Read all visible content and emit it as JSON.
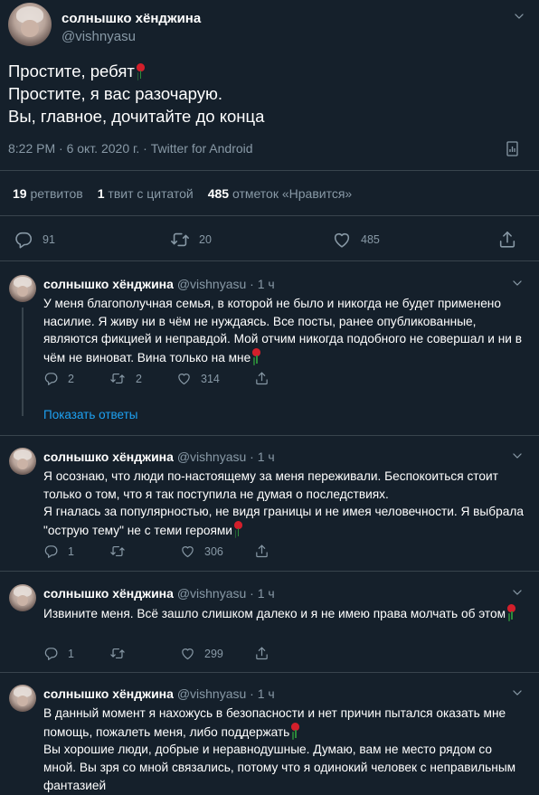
{
  "main_tweet": {
    "name": "солнышко хёнджина",
    "handle": "@vishnyasu",
    "lines": [
      "Простите, ребят",
      "Простите, я вас разочарую.",
      "Вы, главное, дочитайте до конца"
    ],
    "meta": "8:22 PM · 6 окт. 2020 г. · Twitter for Android",
    "stats": {
      "retweets_count": "19",
      "retweets_label": "ретвитов",
      "quotes_count": "1",
      "quotes_label": "твит с цитатой",
      "likes_count": "485",
      "likes_label": "отметок «Нравится»"
    },
    "actions": {
      "replies": "91",
      "retweets": "20",
      "likes": "485"
    }
  },
  "replies": [
    {
      "name": "солнышко хёнджина",
      "handle": "@vishnyasu · 1 ч",
      "text": "У меня благополучная семья, в которой не было и никогда не будет применено насилие. Я живу ни в чём не нуждаясь. Все посты, ранее опубликованные, являются фикцией и неправдой. Мой отчим никогда подобного не совершал и ни в чём не виноват. Вина только на мне",
      "replies": "2",
      "retweets": "2",
      "likes": "314"
    },
    {
      "name": "солнышко хёнджина",
      "handle": "@vishnyasu · 1 ч",
      "text1": "Я осознаю, что люди по-настоящему за меня переживали. Беспокоиться стоит только о том, что я так поступила не думая о последствиях.",
      "text2": "Я гналась за популярностью, не видя границы и не имея человечности. Я выбрала \"острую тему\" не с теми героями",
      "replies": "1",
      "likes": "306"
    },
    {
      "name": "солнышко хёнджина",
      "handle": "@vishnyasu · 1 ч",
      "text": "Извините меня. Всё зашло слишком далеко и я не имею права молчать об этом",
      "replies": "1",
      "likes": "299"
    },
    {
      "name": "солнышко хёнджина",
      "handle": "@vishnyasu · 1 ч",
      "text1": "В данный момент я нахожусь в безопасности и нет причин пытался оказать мне помощь, пожалеть меня, либо поддержать",
      "text2": "Вы хорошие люди, добрые и неравнодушные. Думаю, вам не место рядом со мной. Вы зря со мной связались, потому что я одинокий человек с неправильным фантазией"
    }
  ],
  "show_replies_label": "Показать ответы",
  "icons": {
    "reply": "reply-icon",
    "retweet": "retweet-icon",
    "like": "heart-icon",
    "share": "share-icon",
    "analytics": "analytics-icon",
    "more": "chevron-down-icon",
    "emoji": "rose-emoji"
  },
  "colors": {
    "background": "#15202b",
    "text": "#ffffff",
    "muted": "#8899a6",
    "accent": "#1da1f2",
    "divider": "#38444d"
  }
}
